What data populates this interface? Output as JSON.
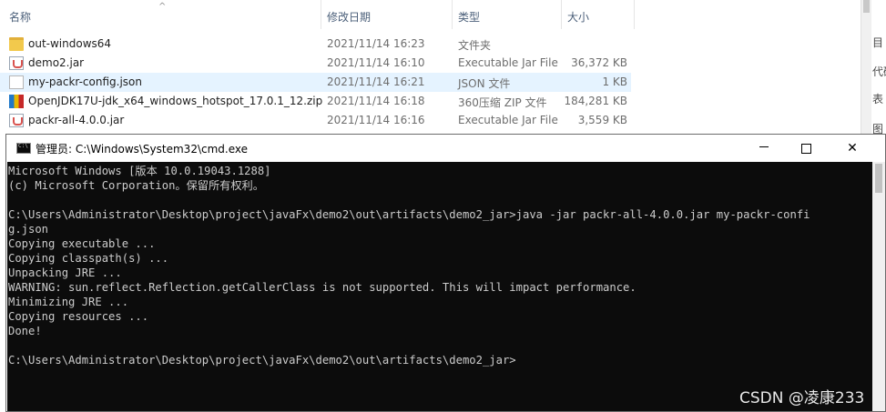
{
  "explorer": {
    "columns": {
      "name": "名称",
      "date": "修改日期",
      "type": "类型",
      "size": "大小"
    },
    "sort_arrow": "^",
    "files": [
      {
        "icon": "folder-icon",
        "name": "out-windows64",
        "date": "2021/11/14 16:23",
        "type": "文件夹",
        "size": ""
      },
      {
        "icon": "jar-icon",
        "name": "demo2.jar",
        "date": "2021/11/14 16:10",
        "type": "Executable Jar File",
        "size": "36,372 KB"
      },
      {
        "icon": "json-icon",
        "name": "my-packr-config.json",
        "date": "2021/11/14 16:21",
        "type": "JSON 文件",
        "size": "1 KB"
      },
      {
        "icon": "zip-icon",
        "name": "OpenJDK17U-jdk_x64_windows_hotspot_17.0.1_12.zip",
        "date": "2021/11/14 16:18",
        "type": "360压缩 ZIP 文件",
        "size": "184,281 KB"
      },
      {
        "icon": "jar-icon",
        "name": "packr-all-4.0.0.jar",
        "date": "2021/11/14 16:16",
        "type": "Executable Jar File",
        "size": "3,559 KB"
      }
    ],
    "right_panel": [
      "目",
      "代码",
      "表",
      "图"
    ]
  },
  "cmd": {
    "title": "管理员: C:\\Windows\\System32\\cmd.exe",
    "minimize": "—",
    "maximize": "☐",
    "close": "✕",
    "lines": [
      "Microsoft Windows [版本 10.0.19043.1288]",
      "(c) Microsoft Corporation。保留所有权利。",
      "",
      "C:\\Users\\Administrator\\Desktop\\project\\javaFx\\demo2\\out\\artifacts\\demo2_jar>java -jar packr-all-4.0.0.jar my-packr-confi",
      "g.json",
      "Copying executable ...",
      "Copying classpath(s) ...",
      "Unpacking JRE ...",
      "WARNING: sun.reflect.Reflection.getCallerClass is not supported. This will impact performance.",
      "Minimizing JRE ...",
      "Copying resources ...",
      "Done!",
      "",
      "C:\\Users\\Administrator\\Desktop\\project\\javaFx\\demo2\\out\\artifacts\\demo2_jar>"
    ]
  },
  "watermark": "CSDN @凌康233"
}
